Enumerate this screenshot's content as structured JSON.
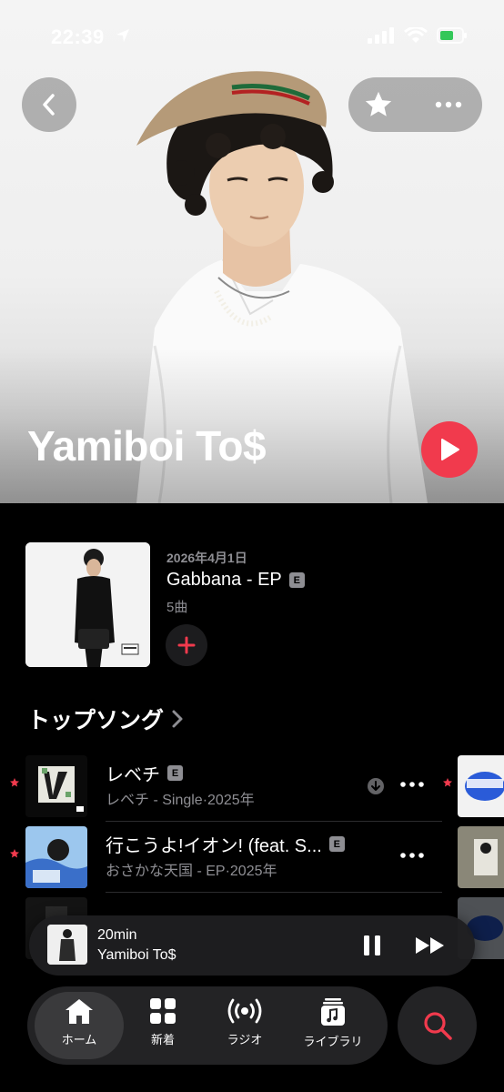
{
  "status": {
    "time": "22:39"
  },
  "artist": {
    "name": "Yamiboi To$"
  },
  "latest_release": {
    "date": "2026年4月1日",
    "title": "Gabbana - EP",
    "explicit_badge": "E",
    "track_count": "5曲"
  },
  "top_songs": {
    "title": "トップソング",
    "songs": [
      {
        "title": "レベチ",
        "explicit": "E",
        "subtitle": "レベチ - Single·2025年",
        "starred": true,
        "downloaded": true
      },
      {
        "title": "行こうよ!イオン! (feat. S...",
        "explicit": "E",
        "subtitle": "おさかな天国 - EP·2025年",
        "starred": true,
        "downloaded": false
      }
    ]
  },
  "mini_player": {
    "title": "20min",
    "artist": "Yamiboi To$"
  },
  "tabs": [
    {
      "label": "ホーム",
      "icon": "home-icon",
      "active": true
    },
    {
      "label": "新着",
      "icon": "grid-icon",
      "active": false
    },
    {
      "label": "ラジオ",
      "icon": "radio-icon",
      "active": false
    },
    {
      "label": "ライブラリ",
      "icon": "library-icon",
      "active": false
    }
  ],
  "colors": {
    "accent": "#f13a4d",
    "background": "#000000",
    "secondary_text": "#8e8e93"
  }
}
